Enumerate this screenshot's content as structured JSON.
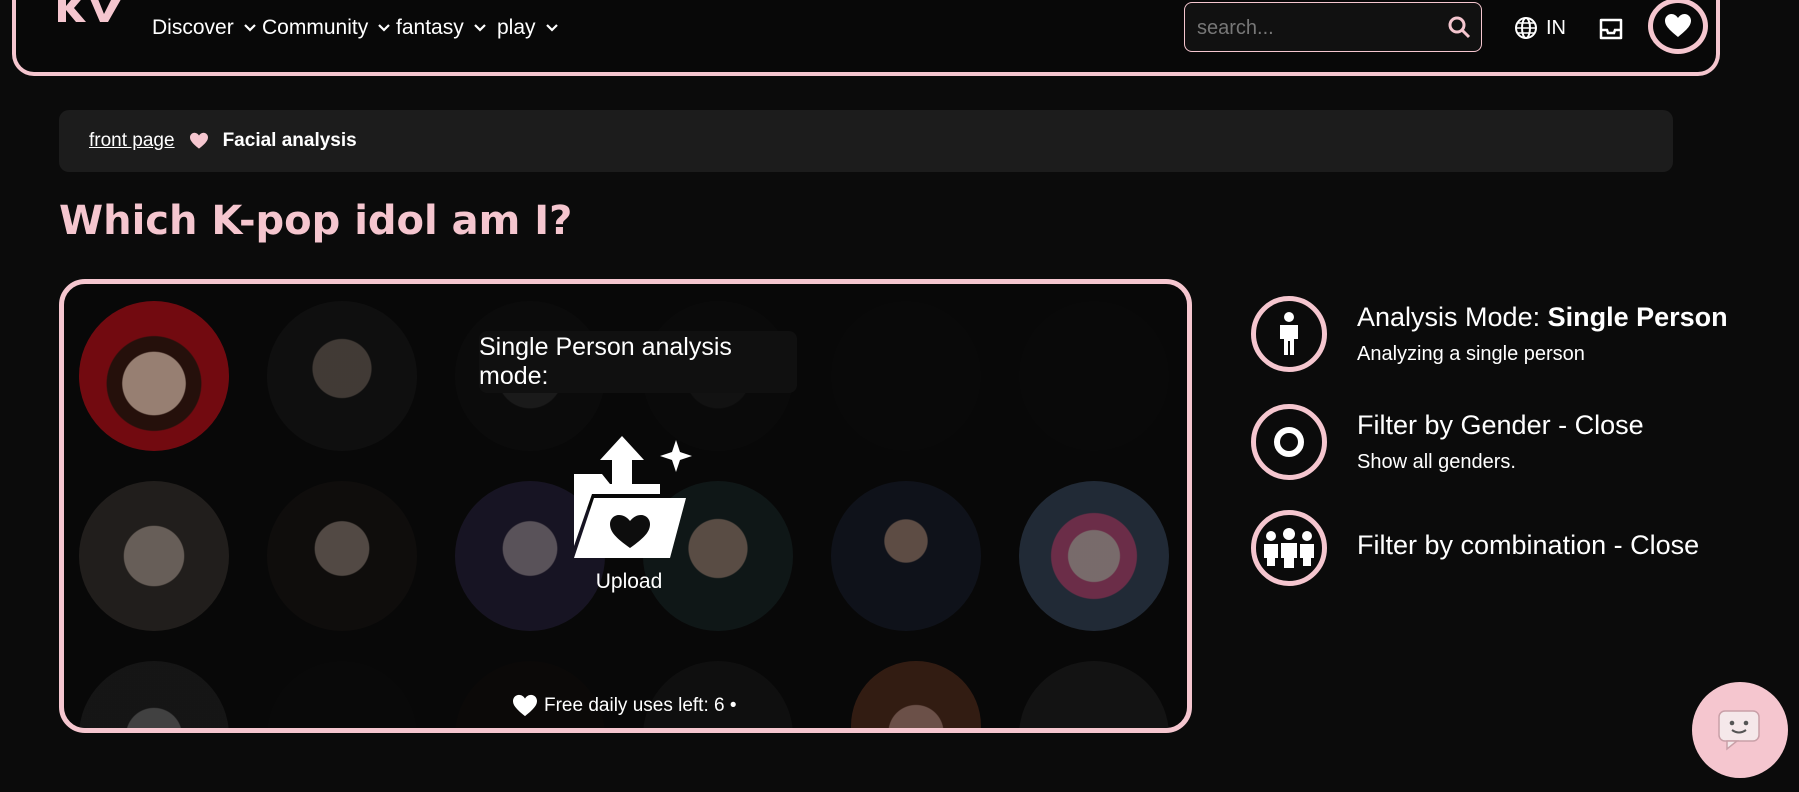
{
  "nav": {
    "logo": "KV",
    "items": [
      {
        "label": "Discover"
      },
      {
        "label": "Community"
      },
      {
        "label": "fantasy"
      },
      {
        "label": "play"
      }
    ],
    "search_placeholder": "search...",
    "lang": "IN"
  },
  "breadcrumb": {
    "home": "front page",
    "current": "Facial analysis"
  },
  "page": {
    "title": "Which K-pop idol am I?"
  },
  "panel": {
    "mode_label": "Single Person analysis mode:",
    "upload_label": "Upload",
    "uses_text": "Free daily uses left: 6 •"
  },
  "options": {
    "analysis": {
      "title_prefix": "Analysis Mode: ",
      "title_value": "Single Person",
      "subtitle": "Analyzing a single person"
    },
    "gender": {
      "title": "Filter by Gender - Close",
      "subtitle": "Show all genders."
    },
    "combination": {
      "title": "Filter by combination - Close"
    }
  },
  "colors": {
    "accent": "#f5c6cf",
    "background": "#0b0b0b"
  }
}
